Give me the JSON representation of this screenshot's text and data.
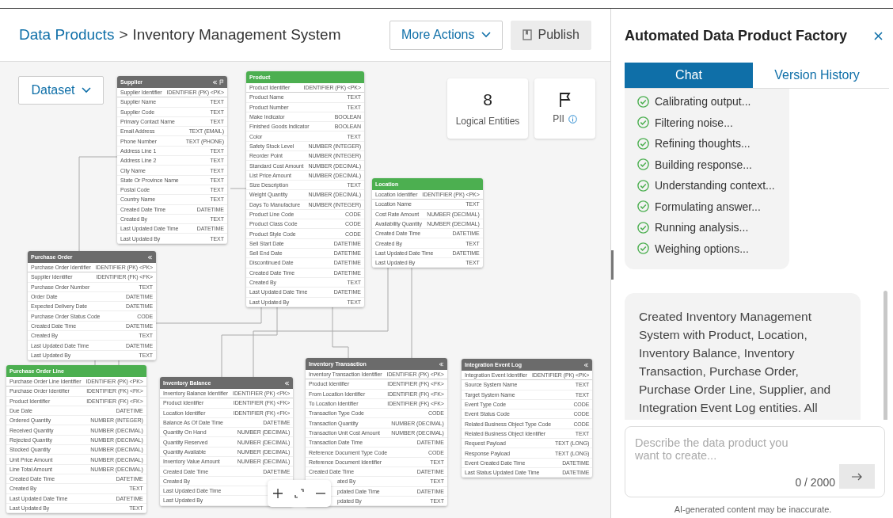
{
  "breadcrumb": {
    "items": [
      "Data Products",
      "Inventory Management System"
    ],
    "separator": ">"
  },
  "header_buttons": [
    {
      "label": "More Actions",
      "kind": "dropdown",
      "disabled": false
    },
    {
      "label": "Publish",
      "kind": "publish",
      "disabled": true
    }
  ],
  "dataset_dropdown": {
    "label": "Dataset"
  },
  "stats": [
    {
      "kind": "count",
      "value": "8",
      "label": "Logical Entities"
    },
    {
      "kind": "flag",
      "label": "PII"
    }
  ],
  "entities": [
    {
      "name": "Supplier",
      "color": "#6b6b6b",
      "collapse_icon": true,
      "flag_icon": true,
      "rows": [
        {
          "name": "Supplier Identifier",
          "type": "IDENTIFIER (PK) <PK>"
        },
        {
          "name": "Supplier Name",
          "type": "TEXT"
        },
        {
          "name": "Supplier Code",
          "type": "TEXT"
        },
        {
          "name": "Primary Contact Name",
          "type": "TEXT"
        },
        {
          "name": "Email Address",
          "type": "TEXT (EMAIL)"
        },
        {
          "name": "Phone Number",
          "type": "TEXT (PHONE)"
        },
        {
          "name": "Address Line 1",
          "type": "TEXT"
        },
        {
          "name": "Address Line 2",
          "type": "TEXT"
        },
        {
          "name": "City Name",
          "type": "TEXT"
        },
        {
          "name": "State Or Province Name",
          "type": "TEXT"
        },
        {
          "name": "Postal Code",
          "type": "TEXT"
        },
        {
          "name": "Country Name",
          "type": "TEXT"
        },
        {
          "name": "Created Date Time",
          "type": "DATETIME"
        },
        {
          "name": "Created By",
          "type": "TEXT"
        },
        {
          "name": "Last Updated Date Time",
          "type": "DATETIME"
        },
        {
          "name": "Last Updated By",
          "type": "TEXT"
        }
      ]
    },
    {
      "name": "Product",
      "color": "#4caf50",
      "collapse_icon": false,
      "rows": [
        {
          "name": "Product Identifier",
          "type": "IDENTIFIER (PK) <PK>"
        },
        {
          "name": "Product Name",
          "type": "TEXT"
        },
        {
          "name": "Product Number",
          "type": "TEXT"
        },
        {
          "name": "Make Indicator",
          "type": "BOOLEAN"
        },
        {
          "name": "Finished Goods Indicator",
          "type": "BOOLEAN"
        },
        {
          "name": "Color",
          "type": "TEXT"
        },
        {
          "name": "Safety Stock Level",
          "type": "NUMBER (INTEGER)"
        },
        {
          "name": "Reorder Point",
          "type": "NUMBER (INTEGER)"
        },
        {
          "name": "Standard Cost Amount",
          "type": "NUMBER (DECIMAL)"
        },
        {
          "name": "List Price Amount",
          "type": "NUMBER (DECIMAL)"
        },
        {
          "name": "Size Description",
          "type": "TEXT"
        },
        {
          "name": "Weight Quantity",
          "type": "NUMBER (DECIMAL)"
        },
        {
          "name": "Days To Manufacture",
          "type": "NUMBER (INTEGER)"
        },
        {
          "name": "Product Line Code",
          "type": "CODE"
        },
        {
          "name": "Product Class Code",
          "type": "CODE"
        },
        {
          "name": "Product Style Code",
          "type": "CODE"
        },
        {
          "name": "Sell Start Date",
          "type": "DATETIME"
        },
        {
          "name": "Sell End Date",
          "type": "DATETIME"
        },
        {
          "name": "Discontinued Date",
          "type": "DATETIME"
        },
        {
          "name": "Created Date Time",
          "type": "DATETIME"
        },
        {
          "name": "Created By",
          "type": "TEXT"
        },
        {
          "name": "Last Updated Date Time",
          "type": "DATETIME"
        },
        {
          "name": "Last Updated By",
          "type": "TEXT"
        }
      ]
    },
    {
      "name": "Purchase Order",
      "color": "#6b6b6b",
      "collapse_icon": true,
      "rows": [
        {
          "name": "Purchase Order Identifier",
          "type": "IDENTIFIER (PK) <PK>"
        },
        {
          "name": "Supplier Identifier",
          "type": "IDENTIFIER (FK) <FK>"
        },
        {
          "name": "Purchase Order Number",
          "type": "TEXT"
        },
        {
          "name": "Order Date",
          "type": "DATETIME"
        },
        {
          "name": "Expected Delivery Date",
          "type": "DATETIME"
        },
        {
          "name": "Purchase Order Status Code",
          "type": "CODE"
        },
        {
          "name": "Created Date Time",
          "type": "DATETIME"
        },
        {
          "name": "Created By",
          "type": "TEXT"
        },
        {
          "name": "Last Updated Date Time",
          "type": "DATETIME"
        },
        {
          "name": "Last Updated By",
          "type": "TEXT"
        }
      ]
    },
    {
      "name": "Location",
      "color": "#4caf50",
      "collapse_icon": false,
      "rows": [
        {
          "name": "Location Identifier",
          "type": "IDENTIFIER (PK) <PK>"
        },
        {
          "name": "Location Name",
          "type": "TEXT"
        },
        {
          "name": "Cost Rate Amount",
          "type": "NUMBER (DECIMAL)"
        },
        {
          "name": "Availability Quantity",
          "type": "NUMBER (DECIMAL)"
        },
        {
          "name": "Created Date Time",
          "type": "DATETIME"
        },
        {
          "name": "Created By",
          "type": "TEXT"
        },
        {
          "name": "Last Updated Date Time",
          "type": "DATETIME"
        },
        {
          "name": "Last Updated By",
          "type": "TEXT"
        }
      ]
    },
    {
      "name": "Purchase Order Line",
      "color": "#4caf50",
      "collapse_icon": false,
      "rows": [
        {
          "name": "Purchase Order Line Identifier",
          "type": "IDENTIFIER (PK) <PK>"
        },
        {
          "name": "Purchase Order Identifier",
          "type": "IDENTIFIER (FK) <FK>"
        },
        {
          "name": "Product Identifier",
          "type": "IDENTIFIER (FK) <FK>"
        },
        {
          "name": "Due Date",
          "type": "DATETIME"
        },
        {
          "name": "Ordered Quantity",
          "type": "NUMBER (INTEGER)"
        },
        {
          "name": "Received Quantity",
          "type": "NUMBER (DECIMAL)"
        },
        {
          "name": "Rejected Quantity",
          "type": "NUMBER (DECIMAL)"
        },
        {
          "name": "Stocked Quantity",
          "type": "NUMBER (DECIMAL)"
        },
        {
          "name": "Unit Price Amount",
          "type": "NUMBER (DECIMAL)"
        },
        {
          "name": "Line Total Amount",
          "type": "NUMBER (DECIMAL)"
        },
        {
          "name": "Created Date Time",
          "type": "DATETIME"
        },
        {
          "name": "Created By",
          "type": "TEXT"
        },
        {
          "name": "Last Updated Date Time",
          "type": "DATETIME"
        },
        {
          "name": "Last Updated By",
          "type": "TEXT"
        }
      ]
    },
    {
      "name": "Inventory Balance",
      "color": "#6b6b6b",
      "collapse_icon": true,
      "rows": [
        {
          "name": "Inventory Balance Identifier",
          "type": "IDENTIFIER (PK) <PK>"
        },
        {
          "name": "Product Identifier",
          "type": "IDENTIFIER (FK) <FK>"
        },
        {
          "name": "Location Identifier",
          "type": "IDENTIFIER (FK) <FK>"
        },
        {
          "name": "Balance As Of Date Time",
          "type": "DATETIME"
        },
        {
          "name": "Quantity On Hand",
          "type": "NUMBER (DECIMAL)"
        },
        {
          "name": "Quantity Reserved",
          "type": "NUMBER (DECIMAL)"
        },
        {
          "name": "Quantity Available",
          "type": "NUMBER (DECIMAL)"
        },
        {
          "name": "Inventory Value Amount",
          "type": "NUMBER (DECIMAL)"
        },
        {
          "name": "Created Date Time",
          "type": "DATETIME"
        },
        {
          "name": "Created By"
        },
        {
          "name": "Last Updated Date Time"
        },
        {
          "name": "Last Updated By"
        }
      ]
    },
    {
      "name": "Inventory Transaction",
      "color": "#6b6b6b",
      "collapse_icon": true,
      "rows": [
        {
          "name": "Inventory Transaction Identifier",
          "type": "IDENTIFIER (PK) <PK>"
        },
        {
          "name": "Product Identifier",
          "type": "IDENTIFIER (FK) <FK>"
        },
        {
          "name": "From Location Identifier",
          "type": "IDENTIFIER (FK) <FK>"
        },
        {
          "name": "To Location Identifier",
          "type": "IDENTIFIER (FK) <FK>"
        },
        {
          "name": "Transaction Type Code",
          "type": "CODE"
        },
        {
          "name": "Transaction Quantity",
          "type": "NUMBER (DECIMAL)"
        },
        {
          "name": "Transaction Unit Cost Amount",
          "type": "NUMBER (DECIMAL)"
        },
        {
          "name": "Transaction Date Time",
          "type": "DATETIME"
        },
        {
          "name": "Reference Document Type Code",
          "type": "CODE"
        },
        {
          "name": "Reference Document Identifier",
          "type": "TEXT"
        },
        {
          "name": "Created Date Time",
          "type": "DATETIME"
        },
        {
          "name": "ated By",
          "type": "TEXT",
          "partly_hidden": true
        },
        {
          "name": "pdated Date Time",
          "type": "DATETIME",
          "partly_hidden": true
        },
        {
          "name": "pdated By",
          "type": "TEXT",
          "partly_hidden": true
        }
      ]
    },
    {
      "name": "Integration Event Log",
      "color": "#6b6b6b",
      "collapse_icon": true,
      "rows": [
        {
          "name": "Integration Event Identifier",
          "type": "IDENTIFIER (PK) <PK>"
        },
        {
          "name": "Source System Name",
          "type": "TEXT"
        },
        {
          "name": "Target System Name",
          "type": "TEXT"
        },
        {
          "name": "Event Type Code",
          "type": "CODE"
        },
        {
          "name": "Event Status Code",
          "type": "CODE"
        },
        {
          "name": "Related Business Object Type Code",
          "type": "CODE"
        },
        {
          "name": "Related Business Object Identifier",
          "type": "TEXT"
        },
        {
          "name": "Request Payload",
          "type": "TEXT (LONG)"
        },
        {
          "name": "Response Payload",
          "type": "TEXT (LONG)"
        },
        {
          "name": "Event Created Date Time",
          "type": "DATETIME"
        },
        {
          "name": "Last Status Updated Date Time",
          "type": "DATETIME"
        }
      ]
    }
  ],
  "panel": {
    "title": "Automated Data Product Factory",
    "tabs": [
      {
        "label": "Chat",
        "selected": true
      },
      {
        "label": "Version History",
        "selected": false
      }
    ],
    "steps": [
      {
        "text": "Calibrating output...",
        "done": true
      },
      {
        "text": "Filtering noise...",
        "done": true
      },
      {
        "text": "Refining thoughts...",
        "done": true
      },
      {
        "text": "Building response...",
        "done": true
      },
      {
        "text": "Understanding context...",
        "done": true
      },
      {
        "text": "Formulating answer...",
        "done": true
      },
      {
        "text": "Running analysis...",
        "done": true
      },
      {
        "text": "Weighing options...",
        "done": true
      }
    ],
    "message": "Created Inventory Management System with Product, Location, Inventory Balance, Inventory Transaction, Purchase Order, Purchase Order Line, Supplier, and Integration Event Log entities. All",
    "input": {
      "placeholder": "Describe the data product you want to create...",
      "counter": "0 / 2000"
    },
    "disclaimer": "AI-generated content may be inaccurate."
  }
}
